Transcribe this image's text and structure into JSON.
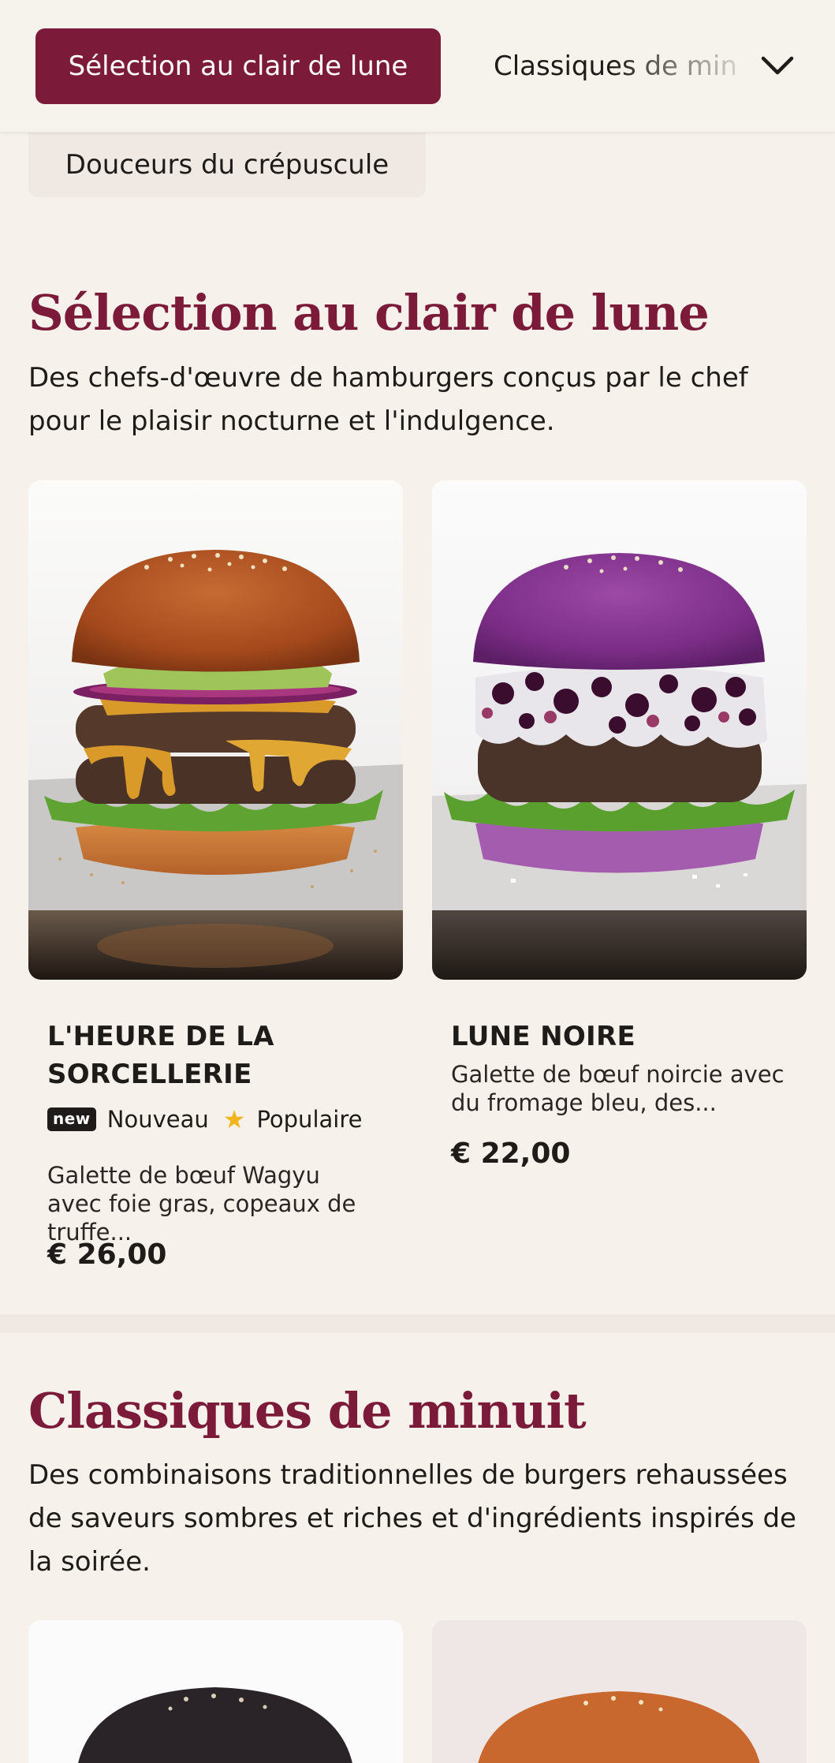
{
  "category_nav": {
    "active": "Sélection au clair de lune",
    "next": "Classiques de minuit",
    "second_row": "Douceurs du crépuscule",
    "expand_icon": "chevron-down-icon"
  },
  "sections": [
    {
      "title": "Sélection au clair de lune",
      "description": "Des chefs-d'œuvre de hamburgers conçus par le chef pour le plaisir nocturne et l'indulgence.",
      "items": [
        {
          "name": "L'HEURE DE LA SORCELLERIE",
          "badge_new": "new",
          "badge_new_label": "Nouveau",
          "badge_popular_label": "Populaire",
          "description": "Galette de bœuf Wagyu avec foie gras, copeaux de truffe...",
          "price": "€ 26,00"
        },
        {
          "name": "LUNE NOIRE",
          "description": "Galette de bœuf noircie avec du fromage bleu, des...",
          "price": "€ 22,00"
        }
      ]
    },
    {
      "title": "Classiques de minuit",
      "description": "Des combinaisons traditionnelles de burgers rehaussées de saveurs sombres et riches et d'ingrédients inspirés de la soirée."
    }
  ],
  "colors": {
    "accent": "#7c1a3a",
    "background": "#f6f2eb",
    "star": "#f2b41c"
  }
}
